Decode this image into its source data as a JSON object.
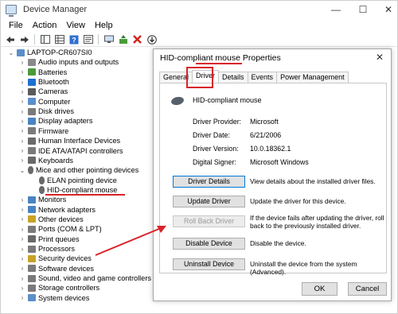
{
  "window": {
    "title": "Device Manager",
    "minimize": "—",
    "restore": "☐",
    "close": "✕"
  },
  "menu": [
    "File",
    "Action",
    "View",
    "Help"
  ],
  "tree": {
    "root": "LAPTOP-CR607SI0",
    "items": [
      {
        "label": "Audio inputs and outputs",
        "icon": "speaker-icon",
        "color": "#8a8a8a"
      },
      {
        "label": "Batteries",
        "icon": "battery-icon",
        "color": "#4c9a3a"
      },
      {
        "label": "Bluetooth",
        "icon": "bluetooth-icon",
        "color": "#1f6fd0"
      },
      {
        "label": "Cameras",
        "icon": "camera-icon",
        "color": "#5a5a5a"
      },
      {
        "label": "Computer",
        "icon": "computer-icon",
        "color": "#5b8fc9"
      },
      {
        "label": "Disk drives",
        "icon": "disk-icon",
        "color": "#7a7a7a"
      },
      {
        "label": "Display adapters",
        "icon": "display-icon",
        "color": "#4a84c2"
      },
      {
        "label": "Firmware",
        "icon": "firmware-icon",
        "color": "#7a7a7a"
      },
      {
        "label": "Human Interface Devices",
        "icon": "hid-icon",
        "color": "#6a6a6a"
      },
      {
        "label": "IDE ATA/ATAPI controllers",
        "icon": "controller-icon",
        "color": "#7a7a7a"
      },
      {
        "label": "Keyboards",
        "icon": "keyboard-icon",
        "color": "#6a6a6a"
      },
      {
        "label": "Mice and other pointing devices",
        "icon": "mouse-icon",
        "color": "#6a6a6a",
        "expanded": true
      },
      {
        "label": "ELAN pointing device",
        "icon": "mouse-icon",
        "color": "#6a6a6a",
        "child": true
      },
      {
        "label": "HID-compliant mouse",
        "icon": "mouse-icon",
        "color": "#6a6a6a",
        "child": true
      },
      {
        "label": "Monitors",
        "icon": "monitor-icon",
        "color": "#4a84c2"
      },
      {
        "label": "Network adapters",
        "icon": "network-icon",
        "color": "#4a84c2"
      },
      {
        "label": "Other devices",
        "icon": "other-devices-icon",
        "color": "#c9a227"
      },
      {
        "label": "Ports (COM & LPT)",
        "icon": "port-icon",
        "color": "#7a7a7a"
      },
      {
        "label": "Print queues",
        "icon": "printer-icon",
        "color": "#6a6a6a"
      },
      {
        "label": "Processors",
        "icon": "processor-icon",
        "color": "#7a7a7a"
      },
      {
        "label": "Security devices",
        "icon": "security-icon",
        "color": "#c9a227"
      },
      {
        "label": "Software devices",
        "icon": "software-icon",
        "color": "#7a7a7a"
      },
      {
        "label": "Sound, video and game controllers",
        "icon": "sound-icon",
        "color": "#7a7a7a"
      },
      {
        "label": "Storage controllers",
        "icon": "storage-icon",
        "color": "#7a7a7a"
      },
      {
        "label": "System devices",
        "icon": "system-icon",
        "color": "#5b8fc9"
      }
    ]
  },
  "dialog": {
    "title": "HID-compliant mouse Properties",
    "close": "✕",
    "tabs": [
      "General",
      "Driver",
      "Details",
      "Events",
      "Power Management"
    ],
    "active_tab": "Driver",
    "device_name": "HID-compliant mouse",
    "info": [
      {
        "label": "Driver Provider:",
        "value": "Microsoft"
      },
      {
        "label": "Driver Date:",
        "value": "6/21/2006"
      },
      {
        "label": "Driver Version:",
        "value": "10.0.18362.1"
      },
      {
        "label": "Digital Signer:",
        "value": "Microsoft Windows"
      }
    ],
    "actions": [
      {
        "button": "Driver Details",
        "desc": "View details about the installed driver files."
      },
      {
        "button": "Update Driver",
        "desc": "Update the driver for this device."
      },
      {
        "button": "Roll Back Driver",
        "desc": "If the device fails after updating the driver, roll back to the previously installed driver.",
        "disabled": true
      },
      {
        "button": "Disable Device",
        "desc": "Disable the device."
      },
      {
        "button": "Uninstall Device",
        "desc": "Uninstall the device from the system (Advanced)."
      }
    ],
    "ok": "OK",
    "cancel": "Cancel"
  },
  "colors": {
    "annotation_red": "#d8232a",
    "focus_blue": "#0078d7"
  }
}
